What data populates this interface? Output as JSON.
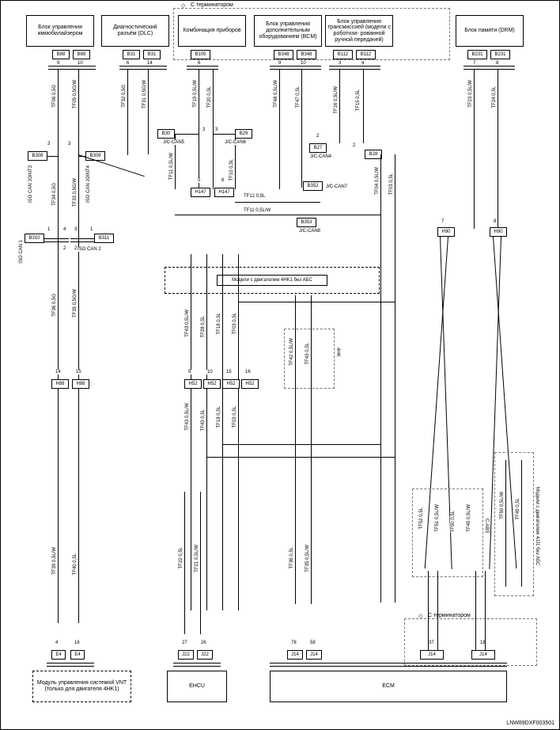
{
  "header": {
    "terminator_top": "С терминатором",
    "terminator_bottom": "С терминатором"
  },
  "blocks": {
    "immob": "Блок управления иммобилайзером",
    "diag": "Диагностический разъём (DLC)",
    "kombi": "Комбинация приборов",
    "bcm": "Блок управления дополнительным оборудованием (BCM)",
    "trans": "Блок управления трансмиссией (модели с роботизи-\nрованной ручной передачей)",
    "drm": "Блок памяти (DRM)",
    "vnt": "Модуль управления системой VNT (только для двигателя 4HK1)",
    "ehcu": "EHCU",
    "ecm": "ECM"
  },
  "joints": {
    "iso3": "ISO CAN JOINT3",
    "iso4": "ISO CAN JOINT4",
    "iso1": "ISO CAN 1",
    "iso2": "ISO CAN 2",
    "jc5": "J/C-CAN5",
    "jc6": "J/C-CAN6",
    "jc4": "J/C-CAN4",
    "jc7": "J/C-CAN7",
    "jc8": "J/C-CAN8"
  },
  "wire": {
    "tf06_05g": "TF06 0,5G",
    "tf05_05gw": "TF05 0,5G/W",
    "tf32_05g": "TF32 0,5G",
    "tf31_05gw": "TF31 0,5G/W",
    "tf34_05g": "TF34 0,5G",
    "tf33_05gw": "TF33 0,5G/W",
    "tf36_05g": "TF36 0,5G",
    "tf35_05gw": "TF35 0,5G/W",
    "tf47": "TF47 0,5L",
    "tf48": "TF48 0,5L/W",
    "tf15": "TF15 0,5L",
    "tf16": "TF16 0,5L/W",
    "tf19_lw": "TF19 0,5L/W",
    "tf20": "TF20 0,5L",
    "tf11_lw": "TF11 0,5L/W",
    "tf10": "TF10 0,5L",
    "tf23": "TF23 0,5L/W",
    "tf24": "TF24 0,5L",
    "tf12_l": "TF12 0,5L",
    "tf11_l": "TF11 0,5L/W",
    "tf04_lw": "TF04 0,5L/W",
    "tf03_l": "TF03 0,5L",
    "tf43_lw": "TF43 0,5L/W",
    "tf28_l": "TF28 0,5L",
    "tf43_l": "TF43 0,5L",
    "tf42_lw": "TF42 0,5L/W",
    "tf39_lw": "TF39 0,5L/W",
    "tf40_l": "TF40 0,5L",
    "tf18_l": "TF18 0,5L",
    "tf22_l": "TF22 0,5L",
    "tf21_lw": "TF21 0,5L/W",
    "tf36_l": "TF36 0,5L",
    "tf35_lw": "TF35 0,5L/W",
    "tf51_lw": "TF51 0,5L/W",
    "tf52_l": "TF52 0,5L",
    "tf50_l": "TF50 0,5L",
    "tf49_lw": "TF49 0,5L/W",
    "tf50_r": "TF50 0,5L/W",
    "tf49_r": "TF49 0,5L"
  },
  "conn": {
    "b88": "B88",
    "b31": "B31",
    "b105": "B105",
    "b348": "B348",
    "b112": "B112",
    "b231": "B231",
    "b308": "B308",
    "b309": "B309",
    "b310": "B310",
    "b311": "B311",
    "b30": "B30",
    "b29": "B29",
    "b27": "B27",
    "b28": "B28",
    "b352": "B352",
    "b353": "B353",
    "h147": "H147",
    "h52": "H52",
    "h90": "H90",
    "h88": "H88",
    "e4": "E4",
    "j22": "J22",
    "j14": "J14"
  },
  "notes": {
    "abs4hk1": "Модели с двигателем 4HK1 без АБС",
    "abs4jj1": "Модели с двигателем 4JJ1 без АБС",
    "cabs": "С-ABS",
    "c4hk": "4HK"
  },
  "partnum": "LNW89DXF003501"
}
